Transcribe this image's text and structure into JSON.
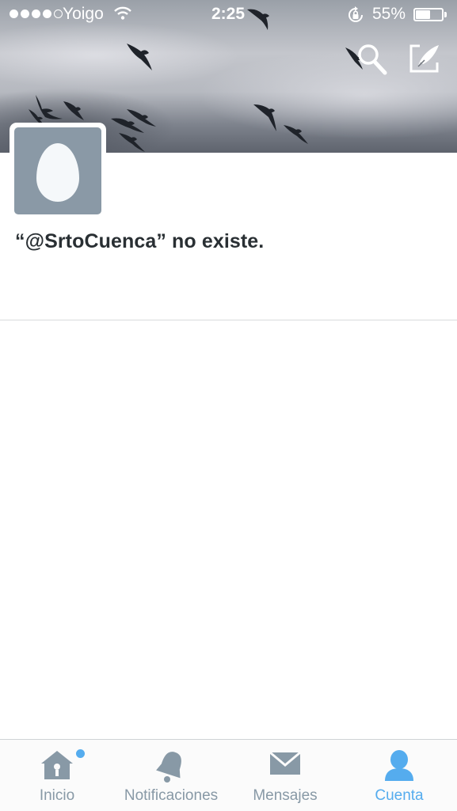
{
  "status_bar": {
    "carrier": "Yoigo",
    "time": "2:25",
    "battery_percent": "55%",
    "battery_level": 0.55,
    "signal_bars_filled": 4,
    "signal_bars_total": 5
  },
  "header": {
    "icons": [
      "search-icon",
      "compose-icon"
    ]
  },
  "profile": {
    "message": "“@SrtoCuenca” no existe."
  },
  "tabbar": {
    "tabs": [
      {
        "label": "Inicio",
        "icon": "home-icon",
        "active": false,
        "has_badge": true
      },
      {
        "label": "Notificaciones",
        "icon": "bell-icon",
        "active": false
      },
      {
        "label": "Mensajes",
        "icon": "envelope-icon",
        "active": false
      },
      {
        "label": "Cuenta",
        "icon": "person-icon",
        "active": true
      }
    ]
  },
  "colors": {
    "accent": "#55acee",
    "inactive": "#8899a6",
    "text": "#292f33",
    "avatar_bg": "#8a99a6"
  }
}
